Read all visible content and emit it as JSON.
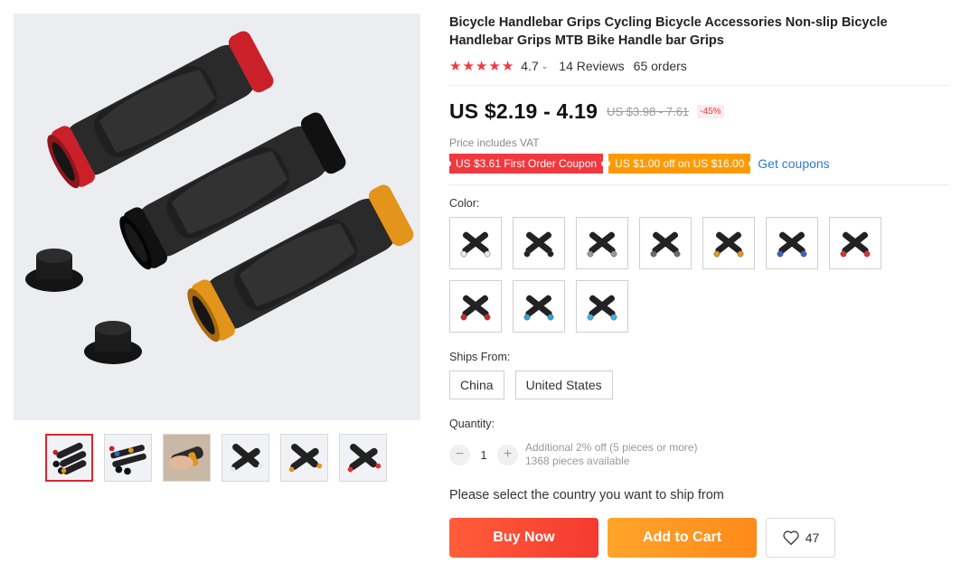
{
  "product": {
    "title": "Bicycle Handlebar Grips Cycling Bicycle Accessories Non-slip Bicycle Handlebar Grips MTB Bike Handle bar Grips",
    "rating": "4.7",
    "reviews": "14 Reviews",
    "orders": "65 orders"
  },
  "price": {
    "current": "US $2.19 - 4.19",
    "original": "US $3.98 - 7.61",
    "discount": "-45%",
    "vat_note": "Price includes VAT"
  },
  "coupons": {
    "first_order": "US $3.61 First Order Coupon",
    "store": "US $1.00 off on US $16.00",
    "get_link": "Get coupons"
  },
  "color": {
    "label": "Color:",
    "options": [
      {
        "name": "white",
        "accent": "#e8e8e8"
      },
      {
        "name": "black",
        "accent": "#222222"
      },
      {
        "name": "black-silver",
        "accent": "#9a9a9a"
      },
      {
        "name": "titanium",
        "accent": "#6b6b6b"
      },
      {
        "name": "gold",
        "accent": "#e09a1c"
      },
      {
        "name": "blue-gold",
        "accent": "#3a63c9"
      },
      {
        "name": "red",
        "accent": "#d8323a"
      },
      {
        "name": "red-black",
        "accent": "#c62a30"
      },
      {
        "name": "blue",
        "accent": "#2aa5d8"
      },
      {
        "name": "light-blue",
        "accent": "#3bb3e6"
      }
    ]
  },
  "shipping": {
    "label": "Ships From:",
    "options": [
      "China",
      "United States"
    ],
    "note": "Please select the country you want to ship from"
  },
  "quantity": {
    "label": "Quantity:",
    "value": "1",
    "minus": "−",
    "plus": "+",
    "discount_info": "Additional 2% off (5 pieces or more)",
    "available": "1368 pieces available"
  },
  "actions": {
    "buy_now": "Buy Now",
    "add_to_cart": "Add to Cart",
    "wishlist_count": "47"
  },
  "colors": {
    "star": "#f0393f",
    "buy_now": "#f43a2f",
    "add_to_cart": "#ff9a04",
    "link": "#2e7ad0",
    "selected_border": "#d9262c"
  },
  "gallery": {
    "thumbnails": [
      {
        "name": "product-main",
        "active": true
      },
      {
        "name": "all-colors",
        "active": false
      },
      {
        "name": "in-hand",
        "active": false
      },
      {
        "name": "white-variant",
        "active": false
      },
      {
        "name": "gold-variant",
        "active": false
      },
      {
        "name": "red-variant",
        "active": false
      }
    ]
  }
}
